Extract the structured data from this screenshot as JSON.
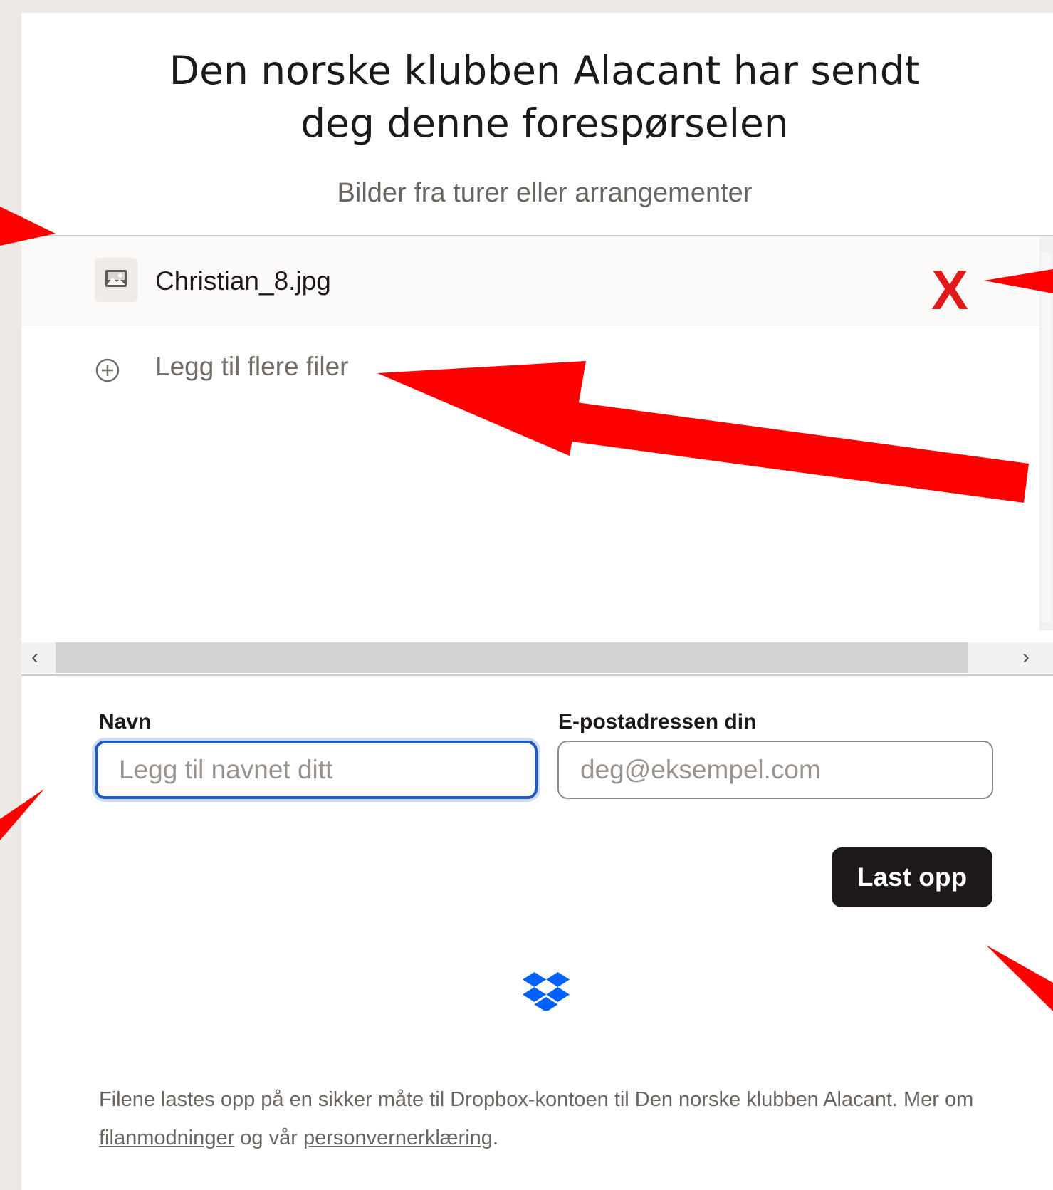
{
  "header": {
    "title_line1": "Den norske klubben Alacant har sendt",
    "title_line2": "deg denne forespørselen",
    "subtitle": "Bilder fra turer eller arrangementer"
  },
  "files": {
    "items": [
      {
        "name": "Christian_8.jpg",
        "icon": "image-file-icon"
      }
    ],
    "remove_label": "X",
    "add_more_label": "Legg til flere filer"
  },
  "form": {
    "name_label": "Navn",
    "name_placeholder": "Legg til navnet ditt",
    "name_value": "",
    "email_label": "E-postadressen din",
    "email_placeholder": "deg@eksempel.com",
    "email_value": "",
    "submit_label": "Last opp"
  },
  "footer": {
    "text_before": "Filene lastes opp på en sikker måte til Dropbox-kontoen til Den norske klubben Alacant. Mer om ",
    "link1": "filanmodninger",
    "text_middle": " og vår ",
    "link2": "personvernerklæring",
    "text_after": "."
  },
  "colors": {
    "annotation_red": "#ff0000",
    "remove_red": "#e0191b",
    "focus_blue": "#1d5bbf",
    "button_dark": "#1e1919",
    "dropbox_blue": "#0061fe"
  }
}
